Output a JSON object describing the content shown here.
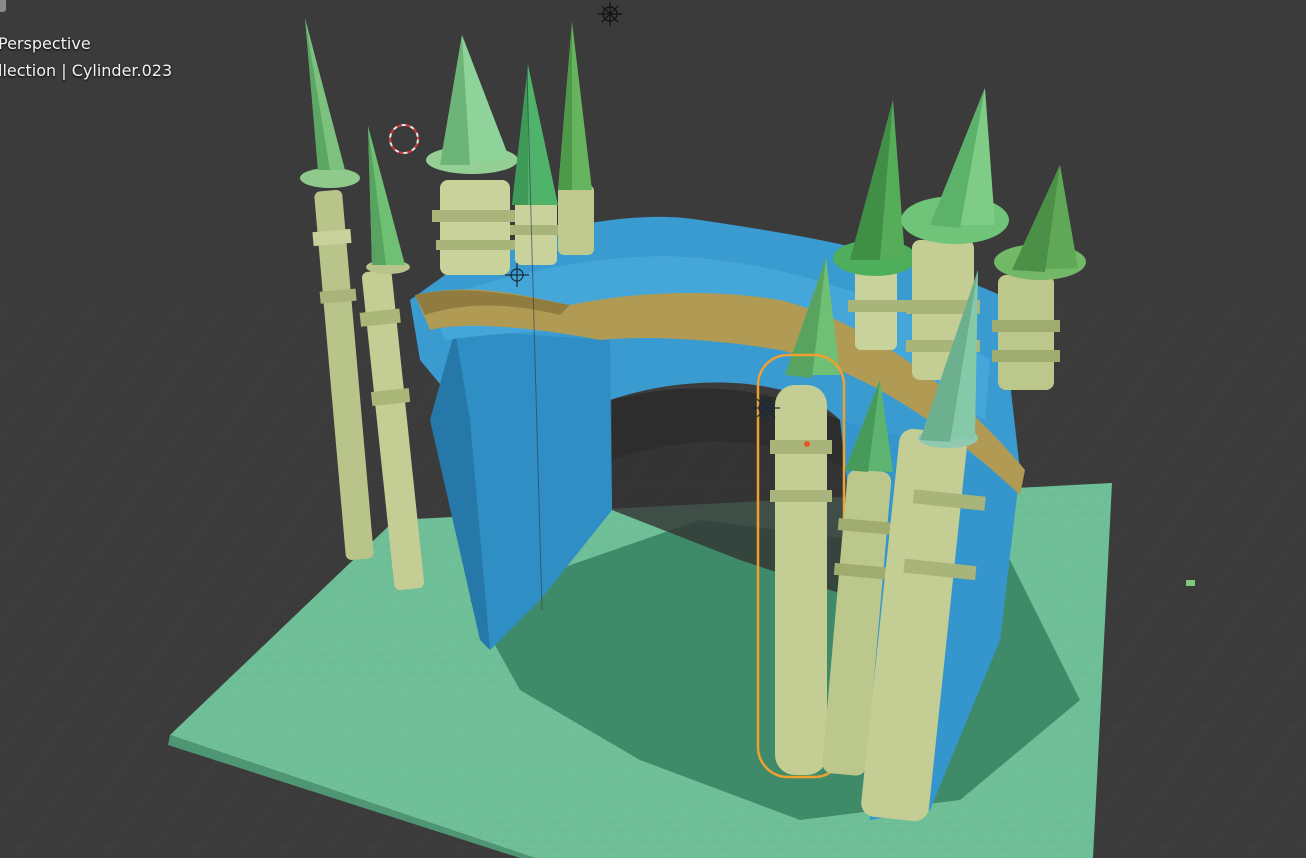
{
  "viewport": {
    "view_mode": "Perspective",
    "collection_prefix": "llection",
    "active_object": "Cylinder.023"
  },
  "colors": {
    "background": "#3b3b3b",
    "grid": "#444444",
    "ground": "#6fbf98",
    "wall": "#3a9bd0",
    "tower": "#c8d29a",
    "cone": "#6fbf74",
    "bridge_band": "#b09a54",
    "selection": "#f0a030",
    "x_axis": "#b04a4a"
  },
  "icons": [
    "3d-cursor-icon",
    "light-icon"
  ]
}
